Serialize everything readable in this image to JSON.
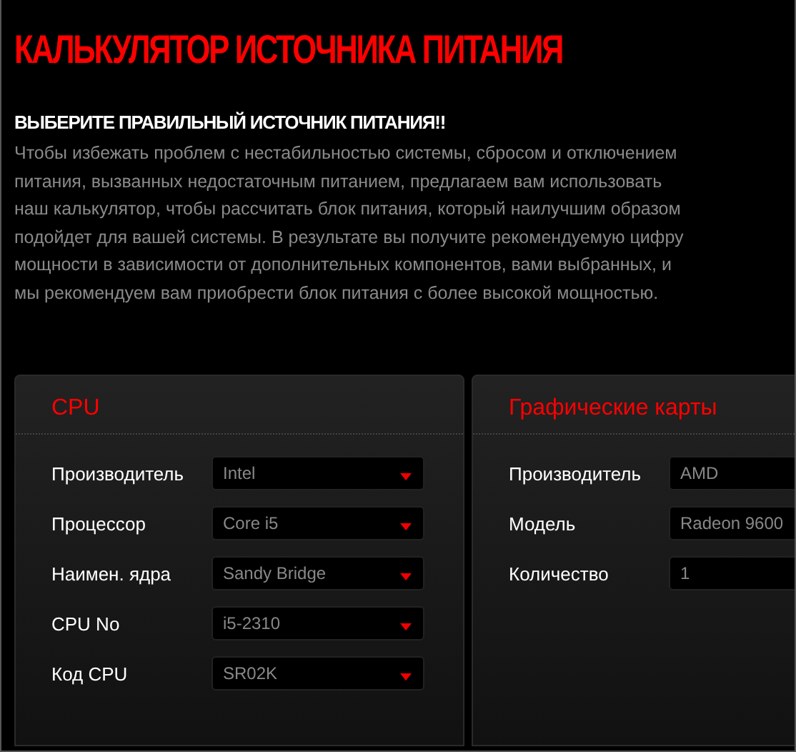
{
  "title": "КАЛЬКУЛЯТОР ИСТОЧНИКА ПИТАНИЯ",
  "subtitle": "ВЫБЕРИТЕ ПРАВИЛЬНЫЙ ИСТОЧНИК ПИТАНИЯ!!",
  "intro": "Чтобы избежать проблем с нестабильностью системы, сбросом и отключением питания, вызванных недостаточным питанием, предлагаем вам использовать наш калькулятор, чтобы рассчитать блок питания, который наилучшим образом подойдет для вашей системы. В результате вы получите рекомендуемую цифру мощности в зависимости от дополнительных компонентов, вами выбранных, и мы рекомендуем вам приобрести блок питания с более высокой мощностью.",
  "panels": [
    {
      "title": "CPU",
      "fields": [
        {
          "label": "Производитель",
          "value": "Intel"
        },
        {
          "label": "Процессор",
          "value": "Core i5"
        },
        {
          "label": "Наимен. ядра",
          "value": "Sandy Bridge"
        },
        {
          "label": "CPU No",
          "value": "i5-2310"
        },
        {
          "label": "Код CPU",
          "value": "SR02K"
        }
      ]
    },
    {
      "title": "Графические карты",
      "fields": [
        {
          "label": "Производитель",
          "value": "AMD"
        },
        {
          "label": "Модель",
          "value": "Radeon 9600"
        },
        {
          "label": "Количество",
          "value": "1"
        }
      ]
    }
  ]
}
